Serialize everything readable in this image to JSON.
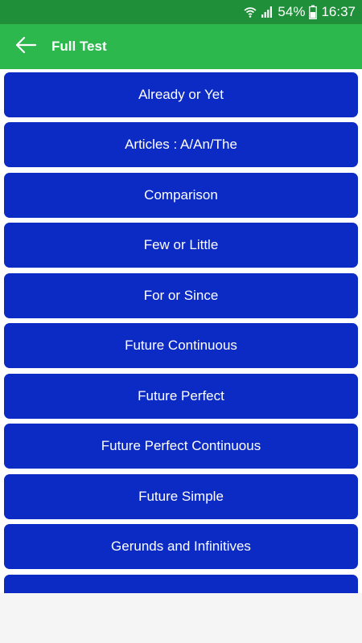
{
  "status": {
    "battery": "54%",
    "time": "16:37"
  },
  "appbar": {
    "title": "Full Test"
  },
  "topics": [
    "Already or Yet",
    "Articles : A/An/The",
    "Comparison",
    "Few or Little",
    "For or Since",
    "Future Continuous",
    "Future Perfect",
    "Future Perfect Continuous",
    "Future Simple",
    "Gerunds and Infinitives",
    ""
  ],
  "colors": {
    "statusbar": "#1f8f3a",
    "appbar": "#2db84e",
    "item": "#0c2bc4"
  }
}
